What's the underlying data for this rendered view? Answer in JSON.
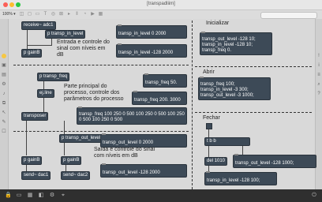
{
  "window": {
    "title": "[transpadliim]",
    "zoom": "100% ▾"
  },
  "colors": {
    "accent": "#f6c744",
    "object_bg": "#3d4a57",
    "canvas_bg": "#d9d9d9"
  },
  "left_section": {
    "receive_obj": "receive~ adc1",
    "param_obj1": "p transp_in_level",
    "gain_obj1": "p gainB",
    "comment1": "Entrada e controle do sinal com níveis em dB",
    "msg_in1": "transp_in_level 0 2000",
    "msg_in2": "transp_in_level -128 2000",
    "param_obj2": "p transp_freq",
    "line_obj": "ej.line",
    "comment2": "Parte principal do processo, controle dos parâmetros do processo",
    "msg_freq1": "transp_freq 50.",
    "msg_freq2": "transp_freq 200. 3000",
    "msg_freq3": "transp_freq 100 250 0 500 100 250 0 500 100 250 0 500 100 250 0 500",
    "transposer": "transposer",
    "param_obj3": "p transp_out_level",
    "gain_obj2": "p gainB",
    "gain_obj3": "p gainB",
    "comment3": "Saída e controle do sinal com níveis em dB",
    "msg_out1": "transp_out_level 0 2000",
    "msg_out2": "transp_out_level -128 2000",
    "send1": "send~ dac1",
    "send2": "send~ dac2"
  },
  "right_section": {
    "init_label": "Inicializar",
    "init_msg": "transp_out_level -128 10;\ntransp_in_level -128 10;\ntransp_freq 0.",
    "open_label": "Abrir",
    "open_msg": "transp_freq 100;\ntransp_in_level -3 300;\ntransp_out_level -3 1000;",
    "close_label": "Fechar",
    "tbb_obj": "t b b",
    "del_obj": "del 1010",
    "close_msg1": "transp_out_level -128 1000;",
    "close_msg2": "transp_in_level -128 100;"
  }
}
